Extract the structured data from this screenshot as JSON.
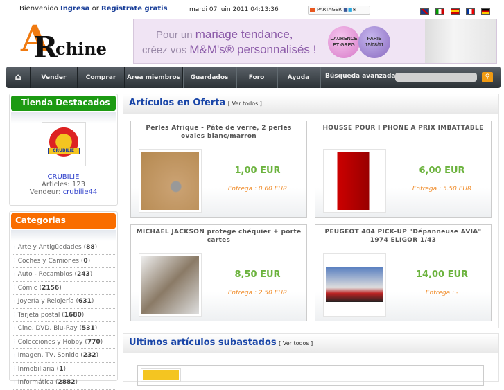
{
  "topbar": {
    "welcome": "Bienvenido",
    "login": "Ingresa",
    "or": "or",
    "register": "Registrate gratis",
    "datetime": "mardi 07 juin 2011 04:13:36",
    "share": "PARTAGER",
    "flags": [
      "english-flag",
      "italian-flag",
      "spanish-flag",
      "french-flag",
      "german-flag"
    ]
  },
  "logo": {
    "text": "ARchine"
  },
  "banner": {
    "line1a": "Pour un",
    "line1b": "mariage tendance,",
    "line2a": "créez vos",
    "line2b": "M&M's® personnalisés !",
    "ball1": "LAURENCE ET GREG",
    "ball2": "PARIS 15/08/11"
  },
  "nav": {
    "items": [
      "Vender",
      "Comprar",
      "Area miembros",
      "Guardados",
      "Foro",
      "Ayuda"
    ],
    "search_label": "Búsqueda avanzada",
    "search_value": ""
  },
  "shop": {
    "title": "Tienda Destacados",
    "logo_text": "CRUBILIE",
    "name": "CRUBILIE",
    "articles": "Articles: 123",
    "vendeur_label": "Vendeur:",
    "vendeur": "crubilie44"
  },
  "categories": {
    "title": "Categorias",
    "items": [
      {
        "name": "Arte y Antigüedades",
        "count": "88"
      },
      {
        "name": "Coches y Camiones",
        "count": "0"
      },
      {
        "name": "Auto - Recambios",
        "count": "243"
      },
      {
        "name": "Cómic",
        "count": "2156"
      },
      {
        "name": "Joyería y Relojería",
        "count": "631"
      },
      {
        "name": "Tarjeta postal",
        "count": "1680"
      },
      {
        "name": "Cine, DVD, Blu-Ray",
        "count": "531"
      },
      {
        "name": "Colecciones y Hobby",
        "count": "770"
      },
      {
        "name": "Imagen, TV, Sonido",
        "count": "232"
      },
      {
        "name": "Inmobiliaria",
        "count": "1"
      },
      {
        "name": "Informática",
        "count": "2882"
      }
    ]
  },
  "offers": {
    "title": "Artículos en Oferta",
    "ver_todos": "[ Ver todos ]",
    "items": [
      {
        "title": "Perles Afrique - Pâte de verre, 2 perles ovales blanc/marron",
        "price": "1,00 EUR",
        "shipping": "Entrega : 0.60 EUR"
      },
      {
        "title": "HOUSSE POUR I PHONE A PRIX IMBATTABLE",
        "price": "6,00 EUR",
        "shipping": "Entrega : 5.50 EUR"
      },
      {
        "title": "MICHAEL JACKSON protege chéquier + porte cartes",
        "price": "8,50 EUR",
        "shipping": "Entrega : 2.50 EUR"
      },
      {
        "title": "PEUGEOT 404 PICK-UP \"Dépanneuse AVIA\" 1974 ELIGOR 1/43",
        "price": "14,00 EUR",
        "shipping": "Entrega : -"
      }
    ]
  },
  "auctions": {
    "title": "Ultimos artículos subastados",
    "ver_todos": "[ Ver todos ]"
  }
}
